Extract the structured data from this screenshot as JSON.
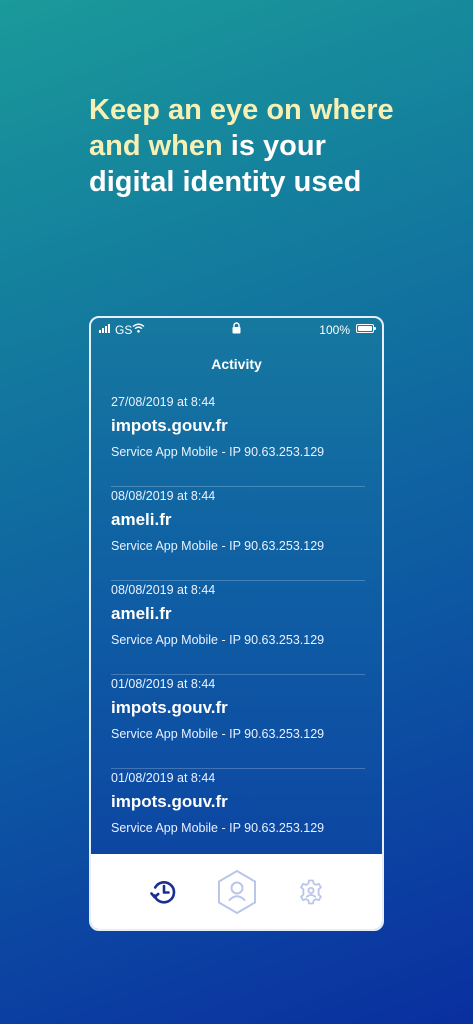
{
  "headline": {
    "highlight_1": "Keep an eye on where",
    "highlight_2": "and when",
    "rest_2": " is your",
    "line_3": "digital identity used"
  },
  "status_bar": {
    "carrier": "GS",
    "battery": "100%"
  },
  "screen_title": "Activity",
  "activities": [
    {
      "date": "27/08/2019 at 8:44",
      "domain": "impots.gouv.fr",
      "detail": "Service App Mobile - IP 90.63.253.129"
    },
    {
      "date": "08/08/2019 at 8:44",
      "domain": "ameli.fr",
      "detail": "Service App Mobile - IP 90.63.253.129"
    },
    {
      "date": "08/08/2019 at 8:44",
      "domain": "ameli.fr",
      "detail": "Service App Mobile - IP 90.63.253.129"
    },
    {
      "date": "01/08/2019 at 8:44",
      "domain": "impots.gouv.fr",
      "detail": "Service App Mobile - IP 90.63.253.129"
    },
    {
      "date": "01/08/2019 at 8:44",
      "domain": "impots.gouv.fr",
      "detail": "Service App Mobile - IP 90.63.253.129"
    }
  ],
  "tabbar": {
    "icons": [
      "history-icon",
      "user-hexagon-icon",
      "settings-gear-icon"
    ],
    "active_color": "#1a2f8f",
    "inactive_color": "#b9c6ea"
  },
  "colors": {
    "headline_highlight": "#f7f0b4"
  }
}
